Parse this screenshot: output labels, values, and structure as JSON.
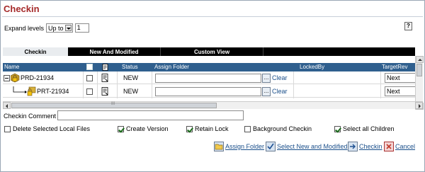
{
  "title": "Checkin",
  "expand": {
    "label": "Expand levels",
    "mode": "Up to",
    "level": "1"
  },
  "help_label": "?",
  "tabs": [
    {
      "label": "Checkin"
    },
    {
      "label": "New And Modified"
    },
    {
      "label": "Custom View"
    }
  ],
  "columns": {
    "name": "Name",
    "status": "Status",
    "assign_folder": "Assign Folder",
    "locked_by": "LockedBy",
    "target_rev": "TargetRev"
  },
  "rows": [
    {
      "name": "PRD-21934",
      "status": "NEW",
      "assign_folder": "",
      "dots": "...",
      "clear": "Clear",
      "target_rev": "Next"
    },
    {
      "name": "PRT-21934",
      "status": "NEW",
      "assign_folder": "",
      "dots": "...",
      "clear": "Clear",
      "target_rev": "Next"
    }
  ],
  "hscroll_grip": "III",
  "comment_label": "Checkin Comment",
  "comment_value": "",
  "options": [
    {
      "label": "Delete Selected Local Files",
      "checked": false
    },
    {
      "label": "Create Version",
      "checked": true
    },
    {
      "label": "Retain Lock",
      "checked": true
    },
    {
      "label": "Background Checkin",
      "checked": false
    },
    {
      "label": "Select all Children",
      "checked": true
    }
  ],
  "actions": [
    {
      "label": "Assign Folder"
    },
    {
      "label": "Select New and Modified"
    },
    {
      "label": "Checkin"
    },
    {
      "label": "Cancel"
    }
  ],
  "colors": {
    "title": "#a52a2a",
    "header": "#2f5f8e",
    "link": "#1a4f8b"
  }
}
